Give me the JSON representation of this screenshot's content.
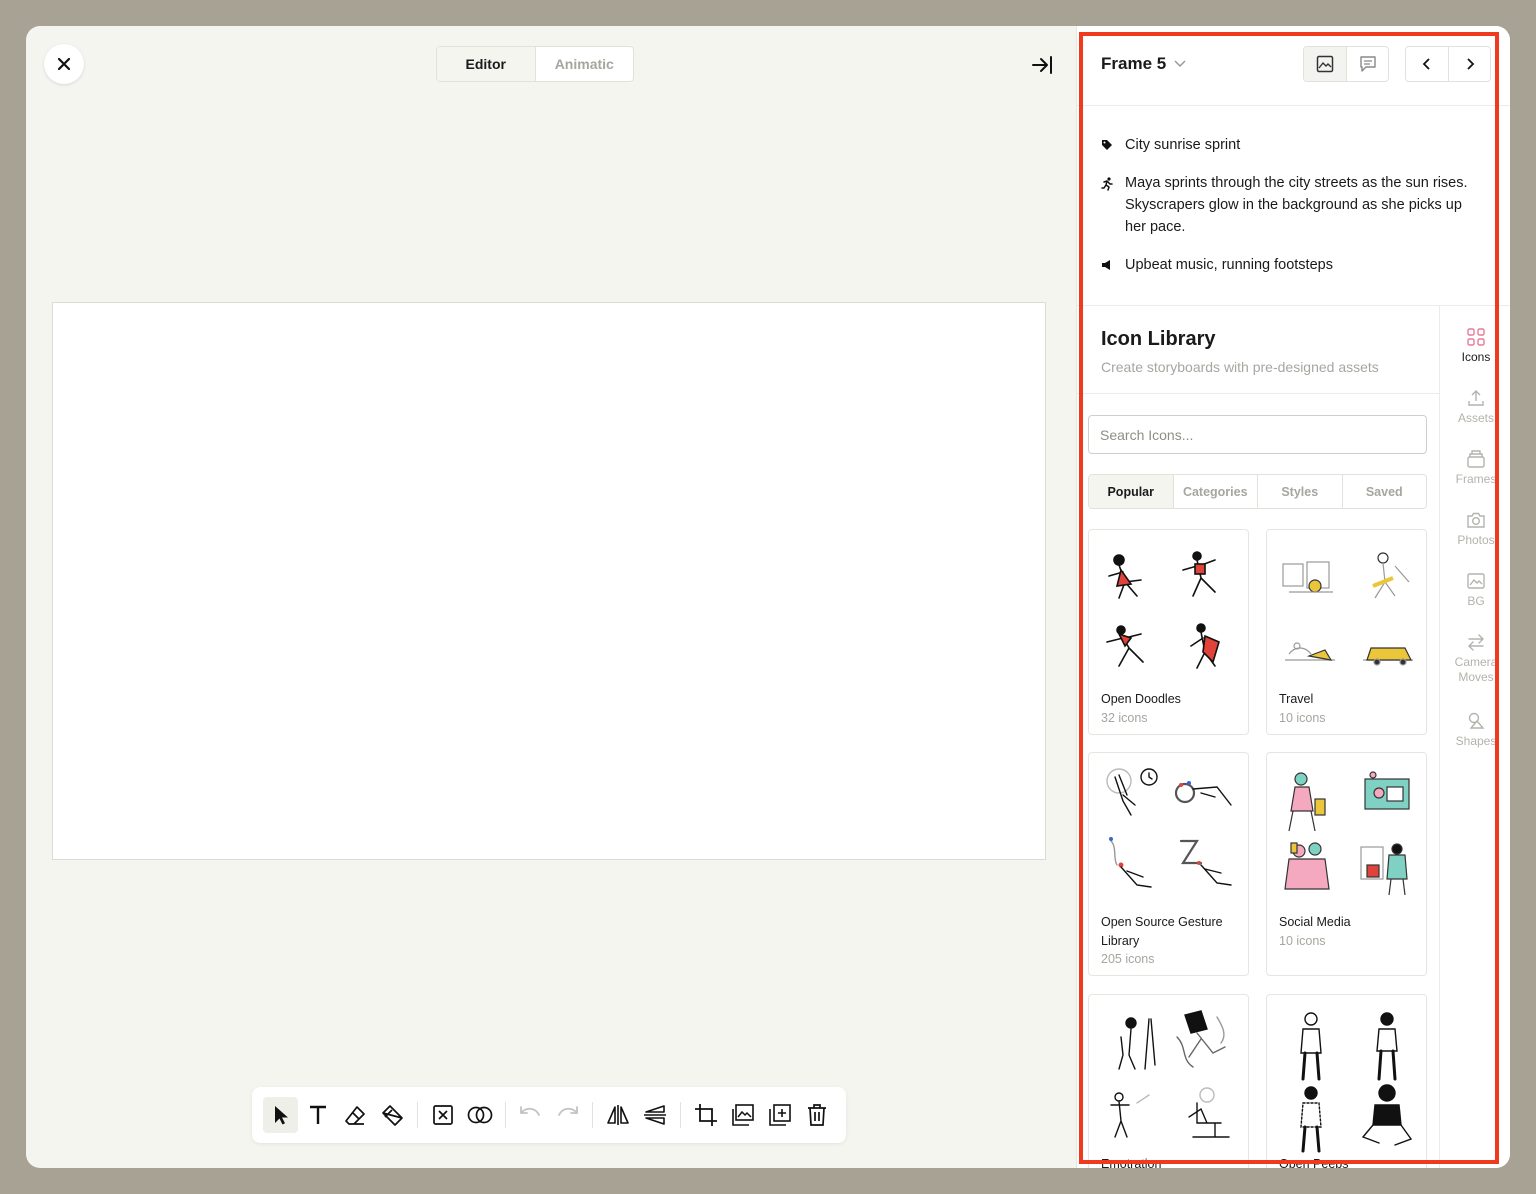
{
  "editor": {
    "modes": [
      "Editor",
      "Animatic"
    ]
  },
  "panel": {
    "frame_title": "Frame 5",
    "meta": {
      "title": "City sunrise sprint",
      "action": "Maya sprints through the city streets as the sun rises. Skyscrapers glow in the background as she picks up her pace.",
      "audio": "Upbeat music, running footsteps"
    },
    "library": {
      "title": "Icon Library",
      "subtitle": "Create storyboards with pre-designed assets",
      "search_placeholder": "Search Icons...",
      "tabs": [
        "Popular",
        "Categories",
        "Styles",
        "Saved"
      ],
      "cards": [
        {
          "name": "Open Doodles",
          "count": "32 icons"
        },
        {
          "name": "Travel",
          "count": "10 icons"
        },
        {
          "name": "Open Source Gesture Library",
          "count": "205 icons"
        },
        {
          "name": "Social Media",
          "count": "10 icons"
        },
        {
          "name": "Emotration",
          "count": ""
        },
        {
          "name": "Open Peeps",
          "count": ""
        }
      ]
    },
    "rail": [
      "Icons",
      "Assets",
      "Frames",
      "Photos",
      "BG",
      "Camera Moves",
      "Shapes"
    ]
  },
  "colors": {
    "accent_pink": "#e8799a",
    "highlight": "#f03a1e",
    "muted": "#a6a6a0"
  }
}
